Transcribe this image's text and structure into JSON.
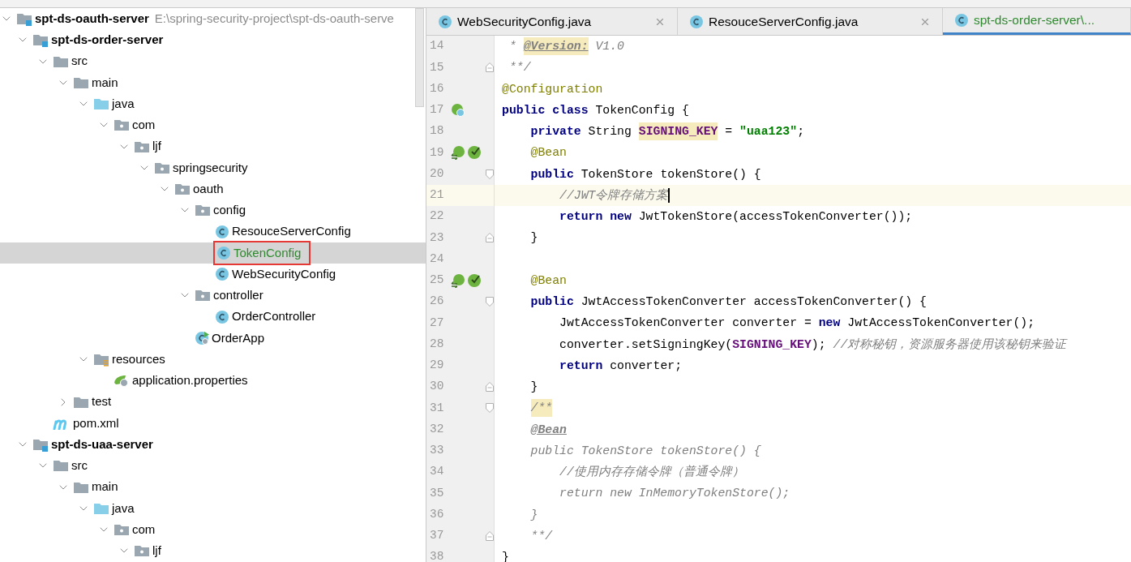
{
  "tree": [
    {
      "kind": "module",
      "label": "spt-ds-oauth-server",
      "path": "E:\\spring-security-project\\spt-ds-oauth-serve",
      "expanded": true,
      "selected": false,
      "children": [
        {
          "kind": "module",
          "label": "spt-ds-order-server",
          "expanded": true,
          "selected": false,
          "children": [
            {
              "kind": "folder",
              "label": "src",
              "expanded": true,
              "selected": false,
              "children": [
                {
                  "kind": "folder",
                  "label": "main",
                  "expanded": true,
                  "selected": false,
                  "children": [
                    {
                      "kind": "source-folder",
                      "label": "java",
                      "expanded": true,
                      "selected": false,
                      "children": [
                        {
                          "kind": "package",
                          "label": "com",
                          "expanded": true,
                          "selected": false,
                          "children": [
                            {
                              "kind": "package",
                              "label": "ljf",
                              "expanded": true,
                              "selected": false,
                              "children": [
                                {
                                  "kind": "package",
                                  "label": "springsecurity",
                                  "expanded": true,
                                  "selected": false,
                                  "children": [
                                    {
                                      "kind": "package",
                                      "label": "oauth",
                                      "expanded": true,
                                      "selected": false,
                                      "children": [
                                        {
                                          "kind": "package",
                                          "label": "config",
                                          "expanded": true,
                                          "selected": false,
                                          "children": [
                                            {
                                              "kind": "class",
                                              "label": "ResouceServerConfig",
                                              "selected": false,
                                              "vcs_new": false
                                            },
                                            {
                                              "kind": "class",
                                              "label": "TokenConfig",
                                              "selected": true,
                                              "vcs_new": true
                                            },
                                            {
                                              "kind": "class",
                                              "label": "WebSecurityConfig",
                                              "selected": false,
                                              "vcs_new": false
                                            }
                                          ]
                                        },
                                        {
                                          "kind": "package",
                                          "label": "controller",
                                          "expanded": true,
                                          "selected": false,
                                          "children": [
                                            {
                                              "kind": "class",
                                              "label": "OrderController",
                                              "selected": false,
                                              "vcs_new": false
                                            }
                                          ]
                                        },
                                        {
                                          "kind": "app-class",
                                          "label": "OrderApp",
                                          "selected": false,
                                          "vcs_new": false
                                        }
                                      ]
                                    }
                                  ]
                                }
                              ]
                            }
                          ]
                        }
                      ]
                    },
                    {
                      "kind": "resources",
                      "label": "resources",
                      "expanded": true,
                      "selected": false,
                      "children": [
                        {
                          "kind": "properties",
                          "label": "application.properties",
                          "selected": false
                        }
                      ]
                    }
                  ]
                },
                {
                  "kind": "folder",
                  "label": "test",
                  "expanded": false,
                  "selected": false
                }
              ]
            },
            {
              "kind": "maven",
              "label": "pom.xml",
              "selected": false
            }
          ]
        },
        {
          "kind": "module",
          "label": "spt-ds-uaa-server",
          "expanded": true,
          "selected": false,
          "children": [
            {
              "kind": "folder",
              "label": "src",
              "expanded": true,
              "selected": false,
              "children": [
                {
                  "kind": "folder",
                  "label": "main",
                  "expanded": true,
                  "selected": false,
                  "children": [
                    {
                      "kind": "source-folder",
                      "label": "java",
                      "expanded": true,
                      "selected": false,
                      "children": [
                        {
                          "kind": "package",
                          "label": "com",
                          "expanded": true,
                          "selected": false,
                          "children": [
                            {
                              "kind": "package",
                              "label": "ljf",
                              "expanded": true,
                              "selected": false
                            }
                          ]
                        }
                      ]
                    }
                  ]
                }
              ]
            }
          ]
        }
      ]
    }
  ],
  "tabs": [
    {
      "title": "WebSecurityConfig.java",
      "selected": false,
      "vcs_new": false,
      "closable": true
    },
    {
      "title": "ResouceServerConfig.java",
      "selected": false,
      "vcs_new": false,
      "closable": true
    },
    {
      "title": "spt-ds-order-server\\...",
      "selected": true,
      "vcs_new": true,
      "closable": false
    }
  ],
  "lines": [
    {
      "num": "14",
      "current": false,
      "tokens": [
        {
          "kind": "comment",
          "text": " * "
        },
        {
          "kind": "doctag-hl",
          "text": "@Version:"
        },
        {
          "kind": "comment",
          "text": " V1.0"
        }
      ]
    },
    {
      "num": "15",
      "current": false,
      "fold": {
        "kind": "end"
      },
      "tokens": [
        {
          "kind": "comment",
          "text": " **/"
        }
      ]
    },
    {
      "num": "16",
      "current": false,
      "tokens": [
        {
          "kind": "annotation",
          "text": "@Configuration"
        }
      ]
    },
    {
      "num": "17",
      "current": false,
      "gutter": [
        {
          "kind": "bean-class"
        }
      ],
      "tokens": [
        {
          "kind": "keyword",
          "text": "public class "
        },
        {
          "kind": "plain",
          "text": "TokenConfig {"
        }
      ]
    },
    {
      "num": "18",
      "current": false,
      "tokens": [
        {
          "kind": "keyword",
          "text": "    private "
        },
        {
          "kind": "plain",
          "text": "String "
        },
        {
          "kind": "field-hl",
          "text": "SIGNING_KEY"
        },
        {
          "kind": "plain",
          "text": " = "
        },
        {
          "kind": "string",
          "text": "\"uaa123\""
        },
        {
          "kind": "plain",
          "text": ";"
        }
      ]
    },
    {
      "num": "19",
      "current": false,
      "gutter": [
        {
          "kind": "bean-navigate"
        },
        {
          "kind": "bean-check"
        }
      ],
      "tokens": [
        {
          "kind": "annotation",
          "text": "    @Bean"
        }
      ]
    },
    {
      "num": "20",
      "current": false,
      "fold": {
        "kind": "start"
      },
      "tokens": [
        {
          "kind": "keyword",
          "text": "    public "
        },
        {
          "kind": "plain",
          "text": "TokenStore tokenStore() {"
        }
      ]
    },
    {
      "num": "21",
      "current": true,
      "tokens": [
        {
          "kind": "comment",
          "text": "        //JWT令牌存储方案"
        }
      ]
    },
    {
      "num": "22",
      "current": false,
      "tokens": [
        {
          "kind": "keyword",
          "text": "        return new "
        },
        {
          "kind": "plain",
          "text": "JwtTokenStore(accessTokenConverter());"
        }
      ]
    },
    {
      "num": "23",
      "current": false,
      "fold": {
        "kind": "end"
      },
      "tokens": [
        {
          "kind": "plain",
          "text": "    }"
        }
      ]
    },
    {
      "num": "24",
      "current": false
    },
    {
      "num": "25",
      "current": false,
      "gutter": [
        {
          "kind": "bean-navigate"
        },
        {
          "kind": "bean-check"
        }
      ],
      "tokens": [
        {
          "kind": "annotation",
          "text": "    @Bean"
        }
      ]
    },
    {
      "num": "26",
      "current": false,
      "fold": {
        "kind": "start"
      },
      "tokens": [
        {
          "kind": "keyword",
          "text": "    public "
        },
        {
          "kind": "plain",
          "text": "JwtAccessTokenConverter accessTokenConverter() {"
        }
      ]
    },
    {
      "num": "27",
      "current": false,
      "tokens": [
        {
          "kind": "plain",
          "text": "        JwtAccessTokenConverter converter = "
        },
        {
          "kind": "keyword",
          "text": "new "
        },
        {
          "kind": "plain",
          "text": "JwtAccessTokenConverter();"
        }
      ]
    },
    {
      "num": "28",
      "current": false,
      "tokens": [
        {
          "kind": "plain",
          "text": "        converter.setSigningKey("
        },
        {
          "kind": "field",
          "text": "SIGNING_KEY"
        },
        {
          "kind": "plain",
          "text": "); "
        },
        {
          "kind": "comment",
          "text": "//对称秘钥，资源服务器使用该秘钥来验证"
        }
      ]
    },
    {
      "num": "29",
      "current": false,
      "tokens": [
        {
          "kind": "keyword",
          "text": "        return "
        },
        {
          "kind": "plain",
          "text": "converter;"
        }
      ]
    },
    {
      "num": "30",
      "current": false,
      "fold": {
        "kind": "end"
      },
      "tokens": [
        {
          "kind": "plain",
          "text": "    }"
        }
      ]
    },
    {
      "num": "31",
      "current": false,
      "fold": {
        "kind": "start"
      },
      "tokens": [
        {
          "kind": "comment-hl",
          "text": "    /**"
        }
      ]
    },
    {
      "num": "32",
      "current": false,
      "tokens": [
        {
          "kind": "doctag",
          "text": "    @Bean"
        }
      ]
    },
    {
      "num": "33",
      "current": false,
      "tokens": [
        {
          "kind": "comment",
          "text": "    public TokenStore tokenStore() {"
        }
      ]
    },
    {
      "num": "34",
      "current": false,
      "tokens": [
        {
          "kind": "comment",
          "text": "        //使用内存存储令牌（普通令牌）"
        }
      ]
    },
    {
      "num": "35",
      "current": false,
      "tokens": [
        {
          "kind": "comment",
          "text": "        return new InMemoryTokenStore();"
        }
      ]
    },
    {
      "num": "36",
      "current": false,
      "tokens": [
        {
          "kind": "comment",
          "text": "    }"
        }
      ]
    },
    {
      "num": "37",
      "current": false,
      "fold": {
        "kind": "end"
      },
      "tokens": [
        {
          "kind": "comment",
          "text": "    **/"
        }
      ]
    },
    {
      "num": "38",
      "current": false,
      "tokens": [
        {
          "kind": "plain",
          "text": "}"
        }
      ]
    }
  ]
}
